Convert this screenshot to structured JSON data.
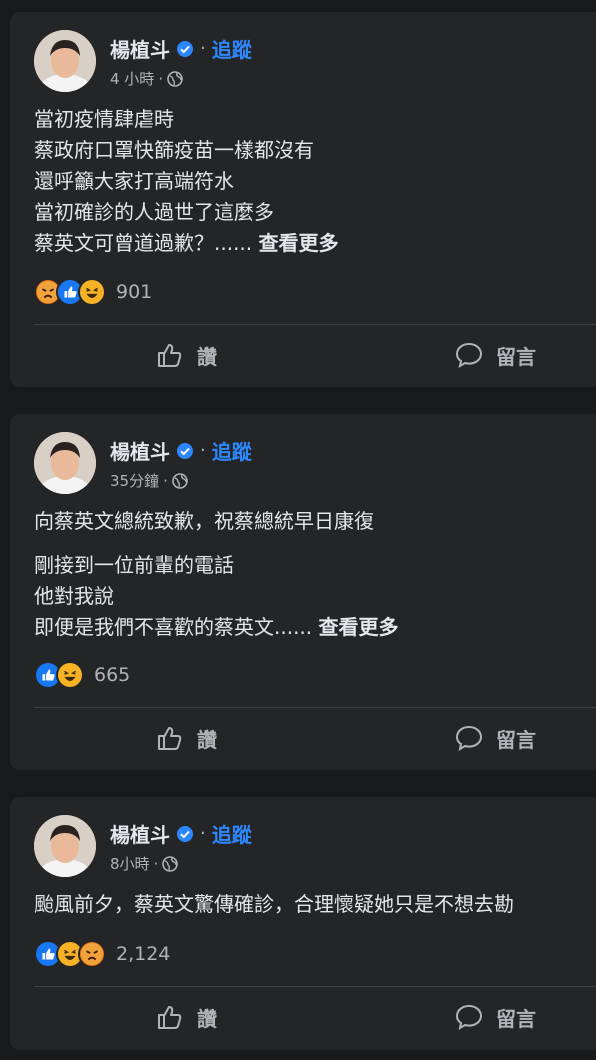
{
  "posts": [
    {
      "author": "楊植斗",
      "follow": "追蹤",
      "time": "4 小時",
      "lines": [
        "當初疫情肆虐時",
        "蔡政府口罩快篩疫苗一樣都沒有",
        "還呼籲大家打高端符水",
        "當初確診的人過世了這麼多"
      ],
      "last_line": "蔡英文可曾道過歉？......",
      "see_more": "查看更多",
      "reactions": [
        "angry-icon",
        "like-icon",
        "haha-icon"
      ],
      "reaction_count": "901",
      "like_label": "讚",
      "comment_label": "留言"
    },
    {
      "author": "楊植斗",
      "follow": "追蹤",
      "time": "35分鐘",
      "headline": "向蔡英文總統致歉，祝蔡總統早日康復",
      "lines": [
        "剛接到一位前輩的電話",
        "他對我說"
      ],
      "last_line": "即便是我們不喜歡的蔡英文......",
      "see_more": "查看更多",
      "reactions": [
        "like-icon",
        "haha-icon"
      ],
      "reaction_count": "665",
      "like_label": "讚",
      "comment_label": "留言"
    },
    {
      "author": "楊植斗",
      "follow": "追蹤",
      "time": "8小時",
      "lines": [
        "颱風前夕，蔡英文驚傳確診，合理懷疑她只是不想去勘"
      ],
      "reactions": [
        "like-icon",
        "haha-icon",
        "angry-icon"
      ],
      "reaction_count": "2,124",
      "like_label": "讚",
      "comment_label": "留言"
    }
  ],
  "colors": {
    "background": "#18191a",
    "card": "#242526",
    "follow_blue": "#2d88ff",
    "secondary_text": "#b0b3b8"
  }
}
